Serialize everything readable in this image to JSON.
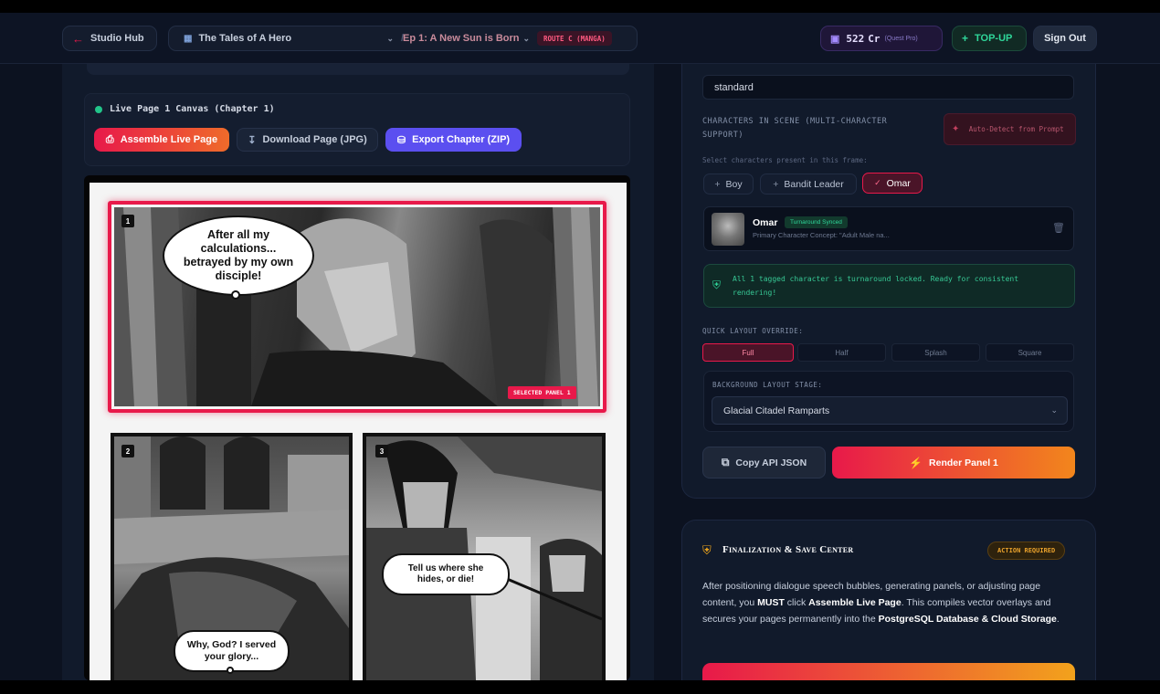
{
  "header": {
    "back_label": "Studio Hub",
    "project_title": "The Tales of A Hero",
    "episode_label": "Ep 1: A New Sun is Born",
    "route_badge": "ROUTE C (MANGA)",
    "credits": "522",
    "credits_unit": "Cr",
    "plan": "(Quest Pro)",
    "topup_label": "TOP-UP",
    "signout_label": "Sign Out"
  },
  "canvas": {
    "status": "Live Page 1 Canvas (Chapter 1)",
    "assemble_label": "Assemble Live Page",
    "download_label": "Download Page (JPG)",
    "export_label": "Export Chapter (ZIP)",
    "selected_tag": "SELECTED PANEL 1",
    "panels": [
      {
        "number": "1",
        "bubble": "After all my calculations... betrayed by my own disciple!"
      },
      {
        "number": "2",
        "bubble": "Why, God? I served your glory..."
      },
      {
        "number": "3",
        "bubble": "Tell us where she hides, or die!"
      }
    ]
  },
  "settings": {
    "style_value": "standard",
    "characters_label": "CHARACTERS IN SCENE (MULTI-CHARACTER SUPPORT)",
    "auto_detect_label": "Auto-Detect from Prompt",
    "select_hint": "Select characters present in this frame:",
    "characters": [
      {
        "name": "Boy",
        "selected": false
      },
      {
        "name": "Bandit Leader",
        "selected": false
      },
      {
        "name": "Omar",
        "selected": true
      }
    ],
    "selected_character": {
      "name": "Omar",
      "badge": "Turnaround Synced",
      "concept": "Primary Character Concept: \"Adult Male na..."
    },
    "lock_notice": "All 1 tagged character is turnaround locked. Ready for consistent rendering!",
    "layout_label": "QUICK LAYOUT OVERRIDE:",
    "layouts": [
      "Full",
      "Half",
      "Splash",
      "Square"
    ],
    "active_layout": "Full",
    "background_label": "BACKGROUND LAYOUT STAGE:",
    "background_value": "Glacial Citadel Ramparts",
    "copy_json_label": "Copy API JSON",
    "render_label": "Render Panel 1"
  },
  "finalize": {
    "title": "Finalization & Save Center",
    "badge": "ACTION REQUIRED",
    "text_1": "After positioning dialogue speech bubbles, generating panels, or adjusting page content, you ",
    "must": "MUST",
    "text_2": " click ",
    "assemble": "Assemble Live Page",
    "text_3": ". This compiles vector overlays and secures your pages permanently into the ",
    "db": "PostgreSQL Database & Cloud Storage",
    "text_4": "."
  },
  "colors": {
    "accent_red": "#e8194a",
    "accent_orange": "#f0901c",
    "accent_purple": "#6b5cff",
    "accent_green": "#22c48a",
    "background": "#0c1220"
  }
}
